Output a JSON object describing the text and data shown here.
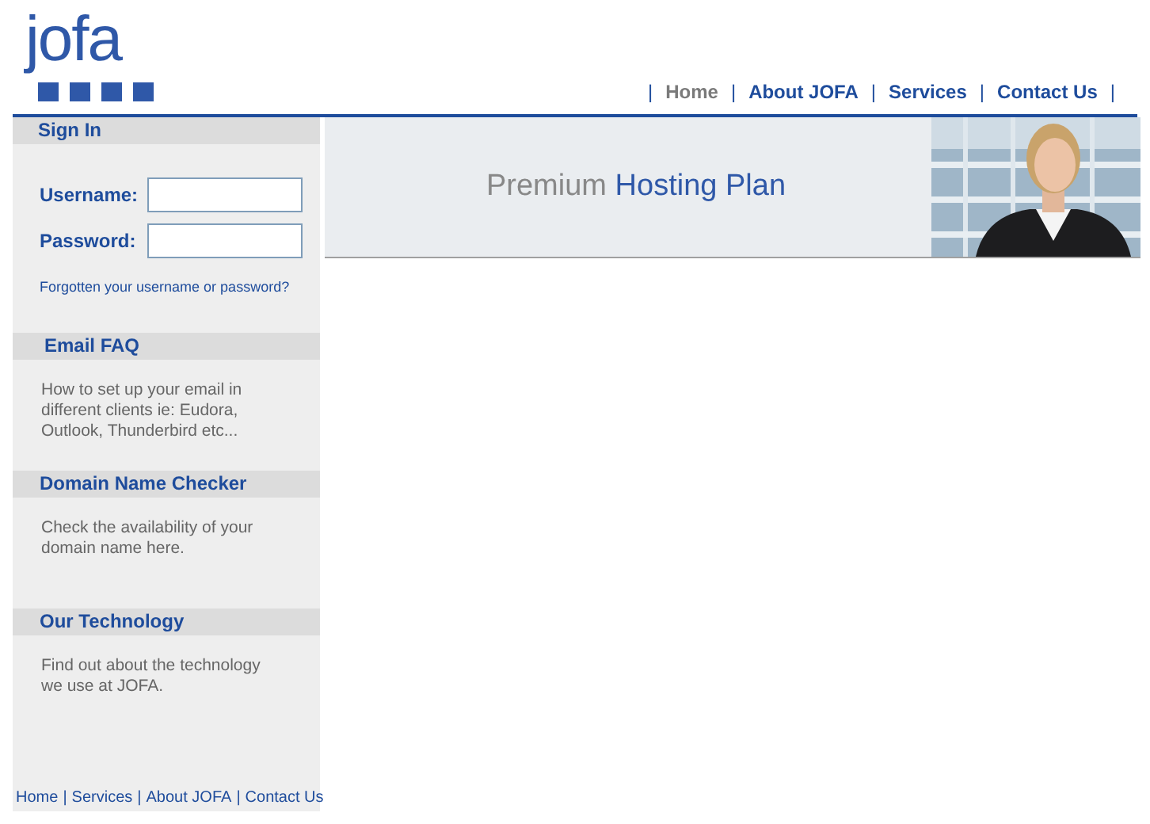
{
  "logo": {
    "text": "jofa"
  },
  "nav": {
    "separator": "|",
    "items": [
      {
        "label": "Home",
        "selected": true
      },
      {
        "label": "About JOFA",
        "selected": false
      },
      {
        "label": "Services",
        "selected": false
      },
      {
        "label": "Contact Us",
        "selected": false
      }
    ]
  },
  "sign_in": {
    "title": "Sign In",
    "username_label": "Username:",
    "password_label": "Password:",
    "forgot_link": "Forgotten your username or password?"
  },
  "banner": {
    "title_plain": "Premium",
    "title_highlight": "Hosting Plan"
  },
  "sections": [
    {
      "title": "Email FAQ",
      "text": "How to set up your email in different clients ie: Eudora, Outlook, Thunderbird etc..."
    },
    {
      "title": "Domain Name Checker",
      "text": "Check the availability of your domain name here."
    },
    {
      "title": "Our Technology",
      "text": "Find out about the technology we use at JOFA."
    }
  ],
  "footer": {
    "separator": "|",
    "links": [
      "Home",
      "Services",
      "About JOFA",
      "Contact Us"
    ]
  }
}
